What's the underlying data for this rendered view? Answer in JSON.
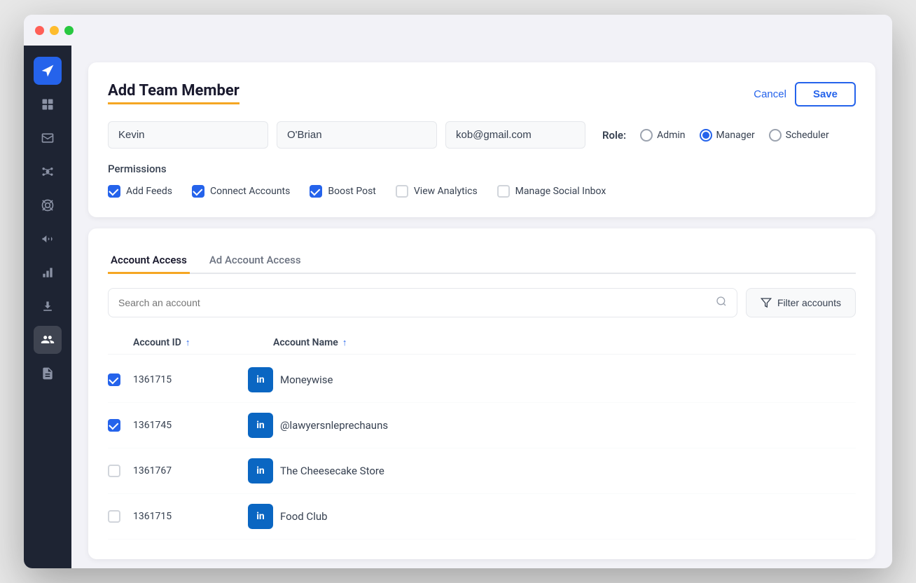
{
  "window": {
    "title": "Add Team Member"
  },
  "titlebar": {
    "controls": [
      "red",
      "yellow",
      "green"
    ]
  },
  "sidebar": {
    "icons": [
      {
        "name": "send-icon",
        "symbol": "➤",
        "active": true
      },
      {
        "name": "grid-icon",
        "symbol": "⊞",
        "active": false
      },
      {
        "name": "chat-icon",
        "symbol": "💬",
        "active": false
      },
      {
        "name": "network-icon",
        "symbol": "⬡",
        "active": false
      },
      {
        "name": "help-icon",
        "symbol": "◎",
        "active": false
      },
      {
        "name": "megaphone-icon",
        "symbol": "📢",
        "active": false
      },
      {
        "name": "analytics-icon",
        "symbol": "↑",
        "active": false
      },
      {
        "name": "download-icon",
        "symbol": "⬇",
        "active": false
      },
      {
        "name": "team-icon",
        "symbol": "👥",
        "active_secondary": true
      },
      {
        "name": "reports-icon",
        "symbol": "☰",
        "active": false
      }
    ]
  },
  "add_team_member": {
    "title": "Add Team Member",
    "cancel_label": "Cancel",
    "save_label": "Save",
    "first_name": "Kevin",
    "last_name": "O'Brian",
    "email": "kob@gmail.com",
    "role_label": "Role:",
    "roles": [
      {
        "label": "Admin",
        "selected": false
      },
      {
        "label": "Manager",
        "selected": true
      },
      {
        "label": "Scheduler",
        "selected": false
      }
    ],
    "permissions_label": "Permissions",
    "permissions": [
      {
        "label": "Add Feeds",
        "checked": true
      },
      {
        "label": "Connect Accounts",
        "checked": true
      },
      {
        "label": "Boost Post",
        "checked": true
      },
      {
        "label": "View Analytics",
        "checked": false
      },
      {
        "label": "Manage Social Inbox",
        "checked": false
      }
    ]
  },
  "account_access": {
    "tabs": [
      {
        "label": "Account Access",
        "active": true
      },
      {
        "label": "Ad Account Access",
        "active": false
      }
    ],
    "search_placeholder": "Search an account",
    "filter_label": "Filter accounts",
    "columns": [
      {
        "label": "Account ID",
        "sort": true
      },
      {
        "label": "Account Name",
        "sort": true
      }
    ],
    "rows": [
      {
        "id": "1361715",
        "platform": "in",
        "name": "Moneywise",
        "checked": true
      },
      {
        "id": "1361745",
        "platform": "in",
        "name": "@lawyersnleprechauns",
        "checked": true
      },
      {
        "id": "1361767",
        "platform": "in",
        "name": "The Cheesecake Store",
        "checked": false
      },
      {
        "id": "1361715",
        "platform": "in",
        "name": "Food Club",
        "checked": false
      }
    ]
  }
}
